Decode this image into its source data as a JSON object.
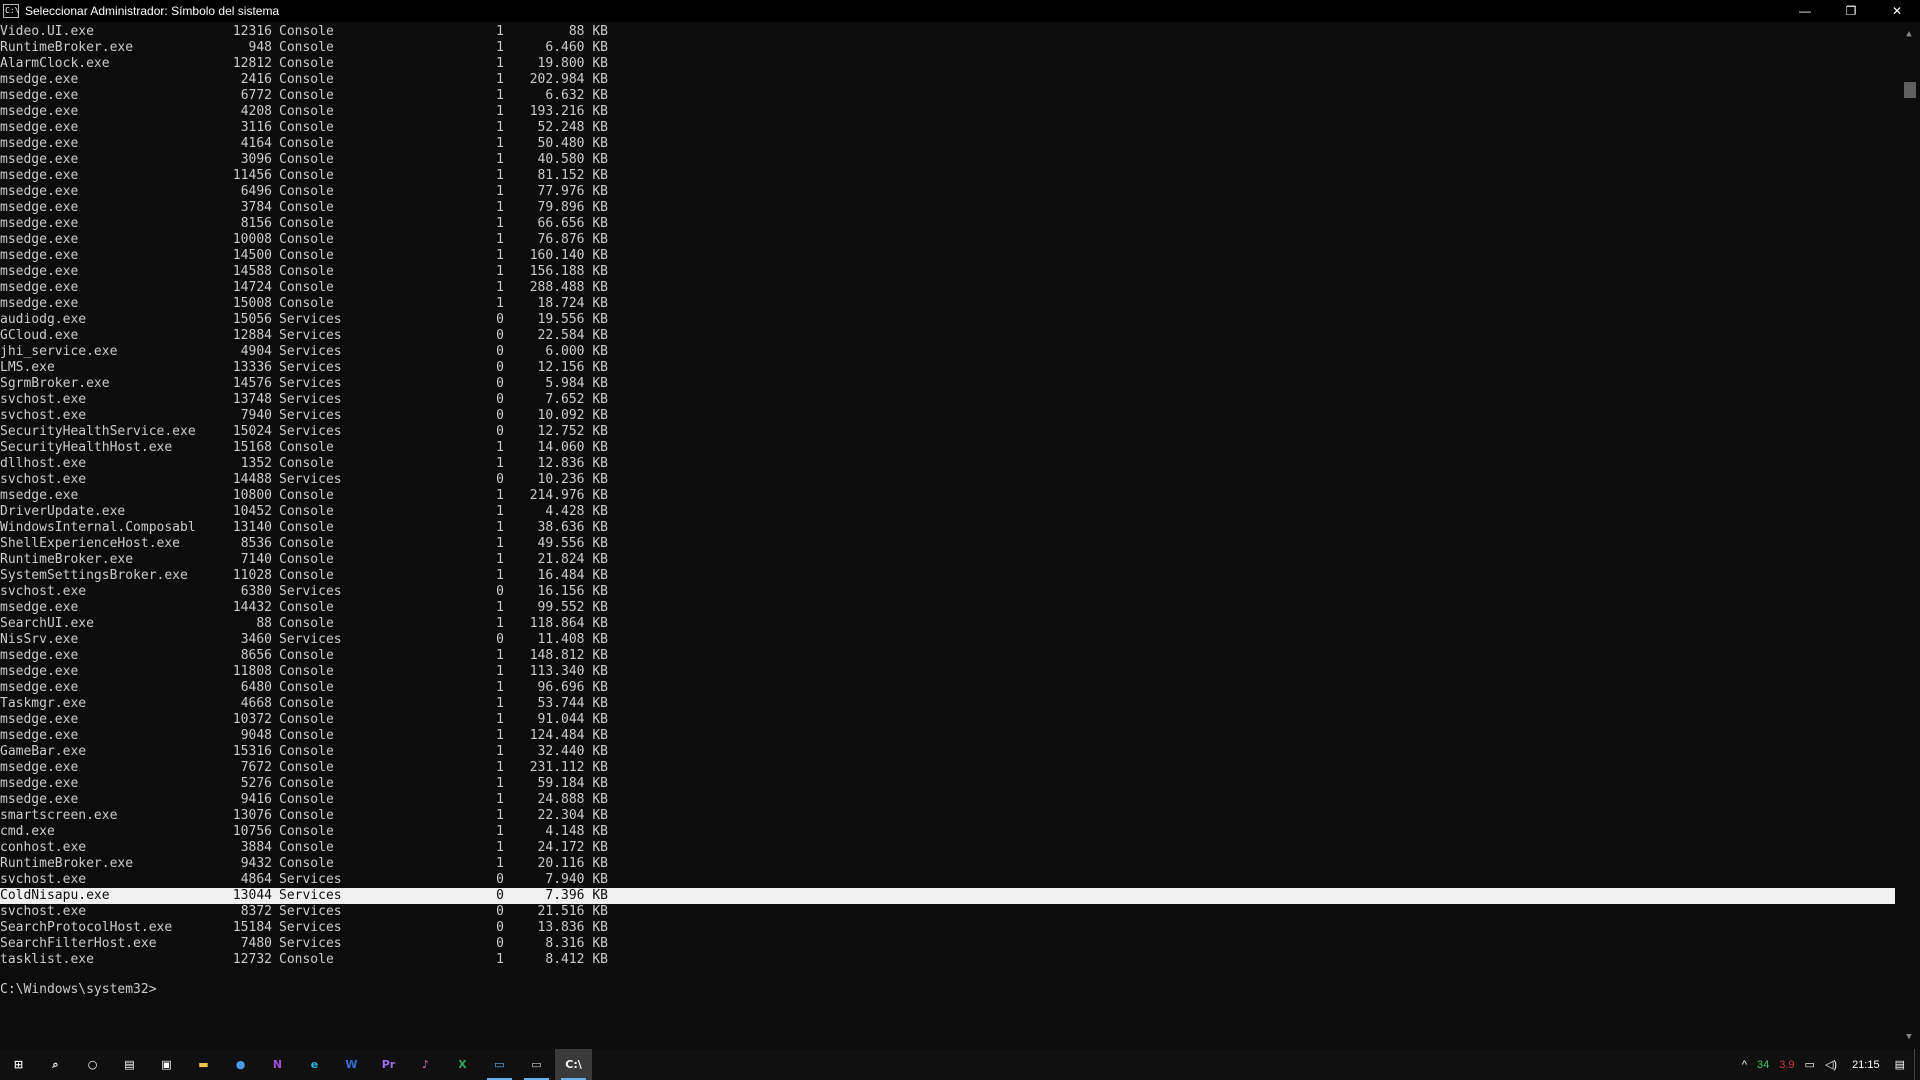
{
  "window": {
    "icon_text": "C:\\",
    "title": "Seleccionar Administrador: Símbolo del sistema",
    "minimize_glyph": "—",
    "restore_glyph": "❐",
    "close_glyph": "✕"
  },
  "columns": [
    "name",
    "pid",
    "session",
    "session_num",
    "memory"
  ],
  "processes": [
    {
      "name": "Video.UI.exe",
      "pid": "12316",
      "session": "Console",
      "num": "1",
      "mem": "88 KB"
    },
    {
      "name": "RuntimeBroker.exe",
      "pid": "948",
      "session": "Console",
      "num": "1",
      "mem": "6.460 KB"
    },
    {
      "name": "AlarmClock.exe",
      "pid": "12812",
      "session": "Console",
      "num": "1",
      "mem": "19.800 KB"
    },
    {
      "name": "msedge.exe",
      "pid": "2416",
      "session": "Console",
      "num": "1",
      "mem": "202.984 KB"
    },
    {
      "name": "msedge.exe",
      "pid": "6772",
      "session": "Console",
      "num": "1",
      "mem": "6.632 KB"
    },
    {
      "name": "msedge.exe",
      "pid": "4208",
      "session": "Console",
      "num": "1",
      "mem": "193.216 KB"
    },
    {
      "name": "msedge.exe",
      "pid": "3116",
      "session": "Console",
      "num": "1",
      "mem": "52.248 KB"
    },
    {
      "name": "msedge.exe",
      "pid": "4164",
      "session": "Console",
      "num": "1",
      "mem": "50.480 KB"
    },
    {
      "name": "msedge.exe",
      "pid": "3096",
      "session": "Console",
      "num": "1",
      "mem": "40.580 KB"
    },
    {
      "name": "msedge.exe",
      "pid": "11456",
      "session": "Console",
      "num": "1",
      "mem": "81.152 KB"
    },
    {
      "name": "msedge.exe",
      "pid": "6496",
      "session": "Console",
      "num": "1",
      "mem": "77.976 KB"
    },
    {
      "name": "msedge.exe",
      "pid": "3784",
      "session": "Console",
      "num": "1",
      "mem": "79.896 KB"
    },
    {
      "name": "msedge.exe",
      "pid": "8156",
      "session": "Console",
      "num": "1",
      "mem": "66.656 KB"
    },
    {
      "name": "msedge.exe",
      "pid": "10008",
      "session": "Console",
      "num": "1",
      "mem": "76.876 KB"
    },
    {
      "name": "msedge.exe",
      "pid": "14500",
      "session": "Console",
      "num": "1",
      "mem": "160.140 KB"
    },
    {
      "name": "msedge.exe",
      "pid": "14588",
      "session": "Console",
      "num": "1",
      "mem": "156.188 KB"
    },
    {
      "name": "msedge.exe",
      "pid": "14724",
      "session": "Console",
      "num": "1",
      "mem": "288.488 KB"
    },
    {
      "name": "msedge.exe",
      "pid": "15008",
      "session": "Console",
      "num": "1",
      "mem": "18.724 KB"
    },
    {
      "name": "audiodg.exe",
      "pid": "15056",
      "session": "Services",
      "num": "0",
      "mem": "19.556 KB"
    },
    {
      "name": "GCloud.exe",
      "pid": "12884",
      "session": "Services",
      "num": "0",
      "mem": "22.584 KB"
    },
    {
      "name": "jhi_service.exe",
      "pid": "4904",
      "session": "Services",
      "num": "0",
      "mem": "6.000 KB"
    },
    {
      "name": "LMS.exe",
      "pid": "13336",
      "session": "Services",
      "num": "0",
      "mem": "12.156 KB"
    },
    {
      "name": "SgrmBroker.exe",
      "pid": "14576",
      "session": "Services",
      "num": "0",
      "mem": "5.984 KB"
    },
    {
      "name": "svchost.exe",
      "pid": "13748",
      "session": "Services",
      "num": "0",
      "mem": "7.652 KB"
    },
    {
      "name": "svchost.exe",
      "pid": "7940",
      "session": "Services",
      "num": "0",
      "mem": "10.092 KB"
    },
    {
      "name": "SecurityHealthService.exe",
      "pid": "15024",
      "session": "Services",
      "num": "0",
      "mem": "12.752 KB"
    },
    {
      "name": "SecurityHealthHost.exe",
      "pid": "15168",
      "session": "Console",
      "num": "1",
      "mem": "14.060 KB"
    },
    {
      "name": "dllhost.exe",
      "pid": "1352",
      "session": "Console",
      "num": "1",
      "mem": "12.836 KB"
    },
    {
      "name": "svchost.exe",
      "pid": "14488",
      "session": "Services",
      "num": "0",
      "mem": "10.236 KB"
    },
    {
      "name": "msedge.exe",
      "pid": "10800",
      "session": "Console",
      "num": "1",
      "mem": "214.976 KB"
    },
    {
      "name": "DriverUpdate.exe",
      "pid": "10452",
      "session": "Console",
      "num": "1",
      "mem": "4.428 KB"
    },
    {
      "name": "WindowsInternal.Composabl",
      "pid": "13140",
      "session": "Console",
      "num": "1",
      "mem": "38.636 KB"
    },
    {
      "name": "ShellExperienceHost.exe",
      "pid": "8536",
      "session": "Console",
      "num": "1",
      "mem": "49.556 KB"
    },
    {
      "name": "RuntimeBroker.exe",
      "pid": "7140",
      "session": "Console",
      "num": "1",
      "mem": "21.824 KB"
    },
    {
      "name": "SystemSettingsBroker.exe",
      "pid": "11028",
      "session": "Console",
      "num": "1",
      "mem": "16.484 KB"
    },
    {
      "name": "svchost.exe",
      "pid": "6380",
      "session": "Services",
      "num": "0",
      "mem": "16.156 KB"
    },
    {
      "name": "msedge.exe",
      "pid": "14432",
      "session": "Console",
      "num": "1",
      "mem": "99.552 KB"
    },
    {
      "name": "SearchUI.exe",
      "pid": "88",
      "session": "Console",
      "num": "1",
      "mem": "118.864 KB"
    },
    {
      "name": "NisSrv.exe",
      "pid": "3460",
      "session": "Services",
      "num": "0",
      "mem": "11.408 KB"
    },
    {
      "name": "msedge.exe",
      "pid": "8656",
      "session": "Console",
      "num": "1",
      "mem": "148.812 KB"
    },
    {
      "name": "msedge.exe",
      "pid": "11808",
      "session": "Console",
      "num": "1",
      "mem": "113.340 KB"
    },
    {
      "name": "msedge.exe",
      "pid": "6480",
      "session": "Console",
      "num": "1",
      "mem": "96.696 KB"
    },
    {
      "name": "Taskmgr.exe",
      "pid": "4668",
      "session": "Console",
      "num": "1",
      "mem": "53.744 KB"
    },
    {
      "name": "msedge.exe",
      "pid": "10372",
      "session": "Console",
      "num": "1",
      "mem": "91.044 KB"
    },
    {
      "name": "msedge.exe",
      "pid": "9048",
      "session": "Console",
      "num": "1",
      "mem": "124.484 KB"
    },
    {
      "name": "GameBar.exe",
      "pid": "15316",
      "session": "Console",
      "num": "1",
      "mem": "32.440 KB"
    },
    {
      "name": "msedge.exe",
      "pid": "7672",
      "session": "Console",
      "num": "1",
      "mem": "231.112 KB"
    },
    {
      "name": "msedge.exe",
      "pid": "5276",
      "session": "Console",
      "num": "1",
      "mem": "59.184 KB"
    },
    {
      "name": "msedge.exe",
      "pid": "9416",
      "session": "Console",
      "num": "1",
      "mem": "24.888 KB"
    },
    {
      "name": "smartscreen.exe",
      "pid": "13076",
      "session": "Console",
      "num": "1",
      "mem": "22.304 KB"
    },
    {
      "name": "cmd.exe",
      "pid": "10756",
      "session": "Console",
      "num": "1",
      "mem": "4.148 KB"
    },
    {
      "name": "conhost.exe",
      "pid": "3884",
      "session": "Console",
      "num": "1",
      "mem": "24.172 KB"
    },
    {
      "name": "RuntimeBroker.exe",
      "pid": "9432",
      "session": "Console",
      "num": "1",
      "mem": "20.116 KB"
    },
    {
      "name": "svchost.exe",
      "pid": "4864",
      "session": "Services",
      "num": "0",
      "mem": "7.940 KB"
    },
    {
      "name": "ColdNisapu.exe",
      "pid": "13044",
      "session": "Services",
      "num": "0",
      "mem": "7.396 KB",
      "selected": true
    },
    {
      "name": "svchost.exe",
      "pid": "8372",
      "session": "Services",
      "num": "0",
      "mem": "21.516 KB"
    },
    {
      "name": "SearchProtocolHost.exe",
      "pid": "15184",
      "session": "Services",
      "num": "0",
      "mem": "13.836 KB"
    },
    {
      "name": "SearchFilterHost.exe",
      "pid": "7480",
      "session": "Services",
      "num": "0",
      "mem": "8.316 KB"
    },
    {
      "name": "tasklist.exe",
      "pid": "12732",
      "session": "Console",
      "num": "1",
      "mem": "8.412 KB"
    }
  ],
  "prompt": "C:\\Windows\\system32>",
  "scrollbar": {
    "up_glyph": "▲",
    "down_glyph": "▼"
  },
  "taskbar": {
    "apps": [
      {
        "name": "windows-start-icon",
        "glyph": "⊞",
        "color": "#ffffff"
      },
      {
        "name": "search-icon",
        "glyph": "⌕",
        "color": "#ffffff"
      },
      {
        "name": "cortana-icon",
        "glyph": "○",
        "color": "#ffffff"
      },
      {
        "name": "task-view-icon",
        "glyph": "▤",
        "color": "#ffffff"
      },
      {
        "name": "store-icon",
        "glyph": "▣",
        "color": "#ffffff"
      },
      {
        "name": "file-explorer-icon",
        "glyph": "▬",
        "color": "#f2c14e"
      },
      {
        "name": "chrome-like-icon",
        "glyph": "●",
        "color": "#4a9ae8"
      },
      {
        "name": "onenote-icon",
        "glyph": "N",
        "color": "#a04ed8"
      },
      {
        "name": "edge-icon",
        "glyph": "e",
        "color": "#2fb3e8"
      },
      {
        "name": "word-icon",
        "glyph": "W",
        "color": "#3b6fd6"
      },
      {
        "name": "premiere-icon",
        "glyph": "Pr",
        "color": "#9a6cff"
      },
      {
        "name": "itunes-icon",
        "glyph": "♪",
        "color": "#e06ad0"
      },
      {
        "name": "excel-icon",
        "glyph": "X",
        "color": "#2faa5a"
      },
      {
        "name": "remote-desktop-icon",
        "glyph": "▭",
        "color": "#6ab0e8"
      },
      {
        "name": "network-app-icon",
        "glyph": "▭",
        "color": "#cccccc"
      },
      {
        "name": "command-prompt-icon",
        "glyph": "C:\\",
        "color": "#ffffff"
      }
    ],
    "tray": {
      "chevron": "^",
      "green_num": "34",
      "red_num": "3.9",
      "network_glyph": "▭",
      "volume_glyph": "◁)",
      "clock": "21:15",
      "notification_glyph": "▤"
    }
  }
}
